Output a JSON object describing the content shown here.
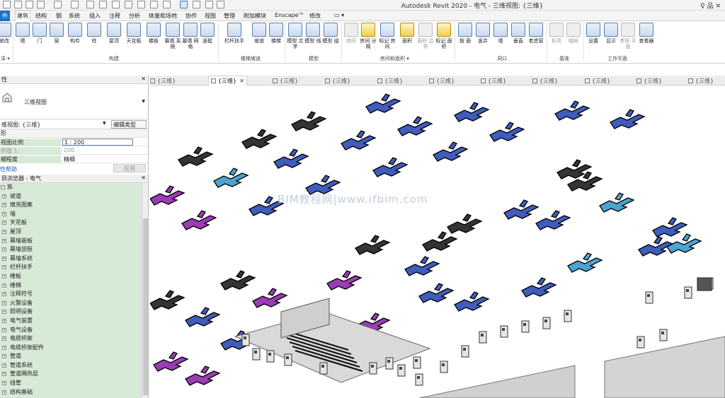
{
  "window": {
    "title": "Autodesk Revit 2020 - 电气 - 三维视图: {三维}",
    "right_tools": "♀ 品 ✕"
  },
  "ribbon_tabs": [
    "件",
    "建筑",
    "结构",
    "钢",
    "系统",
    "插入",
    "注释",
    "分析",
    "体量和场地",
    "协作",
    "视图",
    "管理",
    "附加模块",
    "Enscape™",
    "修改"
  ],
  "ribbon": {
    "tools": [
      {
        "label": "修改",
        "icon": "modify-icon"
      },
      {
        "label": "墙",
        "icon": "wall-icon"
      },
      {
        "label": "门",
        "icon": "door-icon"
      },
      {
        "label": "窗",
        "icon": "window-icon"
      },
      {
        "label": "构件",
        "icon": "component-icon"
      },
      {
        "label": "柱",
        "icon": "column-icon"
      },
      {
        "label": "屋顶",
        "icon": "roof-icon"
      },
      {
        "label": "天花板",
        "icon": "ceiling-icon"
      },
      {
        "label": "楼板",
        "icon": "floor-icon"
      },
      {
        "label": "幕墙\n系统",
        "icon": "curtain-system-icon"
      },
      {
        "label": "幕墙\n网格",
        "icon": "curtain-grid-icon"
      },
      {
        "label": "竖梃",
        "icon": "mullion-icon"
      },
      {
        "label": "栏杆扶手",
        "icon": "railing-icon"
      },
      {
        "label": "坡道",
        "icon": "ramp-icon"
      },
      {
        "label": "楼梯",
        "icon": "stair-icon"
      },
      {
        "label": "模型\n文字",
        "icon": "model-text-icon"
      },
      {
        "label": "模型\n线",
        "icon": "model-line-icon"
      },
      {
        "label": "模型\n组",
        "icon": "model-group-icon"
      },
      {
        "label": "房间",
        "icon": "room-icon"
      },
      {
        "label": "房间\n分隔",
        "icon": "room-separator-icon"
      },
      {
        "label": "标记\n房间",
        "icon": "tag-room-icon"
      },
      {
        "label": "面积",
        "icon": "area-icon"
      },
      {
        "label": "面积\n边界",
        "icon": "area-boundary-icon"
      },
      {
        "label": "标记\n面积",
        "icon": "tag-area-icon"
      },
      {
        "label": "按\n面",
        "icon": "by-face-icon"
      },
      {
        "label": "竖井",
        "icon": "shaft-icon"
      },
      {
        "label": "墙",
        "icon": "wall-opening-icon"
      },
      {
        "label": "垂直",
        "icon": "vertical-icon"
      },
      {
        "label": "老虎窗",
        "icon": "dormer-icon"
      },
      {
        "label": "标高",
        "icon": "level-icon"
      },
      {
        "label": "轴网",
        "icon": "grid-icon"
      },
      {
        "label": "设置",
        "icon": "set-icon"
      },
      {
        "label": "显示",
        "icon": "show-icon"
      },
      {
        "label": "参照\n平面",
        "icon": "ref-plane-icon"
      },
      {
        "label": "查看器",
        "icon": "viewer-icon"
      }
    ],
    "groups": [
      "泽 ▾",
      "构建",
      "楼梯坡道",
      "模型",
      "房间和面积 ▾",
      "洞口",
      "基准",
      "工作平面"
    ]
  },
  "view_tabs": [
    {
      "label": "{三维}",
      "active": false
    },
    {
      "label": "{三维}",
      "active": true
    },
    {
      "label": "{三维}",
      "active": false
    },
    {
      "label": "{三维}",
      "active": false
    },
    {
      "label": "{三维}",
      "active": false
    },
    {
      "label": "{三维}",
      "active": false
    },
    {
      "label": "{三维}",
      "active": false
    },
    {
      "label": "{三维}",
      "active": false
    },
    {
      "label": "{三维}",
      "active": false
    },
    {
      "label": "{三维}",
      "active": false
    },
    {
      "label": "{三维}",
      "active": false
    }
  ],
  "properties": {
    "header": "性",
    "type_name": "三维视图",
    "filter": "维视图: {三维}",
    "edit_type": "编辑类型",
    "section": "形",
    "rows": [
      {
        "key": "视图比例",
        "value": "1 : 200"
      },
      {
        "key": "例值 1:",
        "value": "200"
      },
      {
        "key": "细程度",
        "value": "精细"
      }
    ],
    "help": "性帮助",
    "apply": "应用"
  },
  "browser": {
    "header": "目浏览器 - 电气",
    "root": "族",
    "items": [
      "坡道",
      "填充图案",
      "墙",
      "天花板",
      "屋顶",
      "幕墙嵌板",
      "幕墙竖梃",
      "幕墙系统",
      "栏杆扶手",
      "楼板",
      "楼梯",
      "注释符号",
      "火警设备",
      "照明设备",
      "电气装置",
      "电气设备",
      "电缆桥架",
      "电缆桥架配件",
      "管道",
      "管道系统",
      "管道隔热层",
      "线管",
      "结构基础"
    ]
  },
  "viewport": {
    "watermark": "BIM教程网|www.ifbim.com"
  },
  "colors": {
    "accent": "#1e72c4",
    "browser_bg": "#d7ead7",
    "fixture_black": "#111111",
    "fixture_blue": "#1f3fb0",
    "fixture_purple": "#8a1aa8",
    "fixture_cyan": "#2a95c8"
  }
}
